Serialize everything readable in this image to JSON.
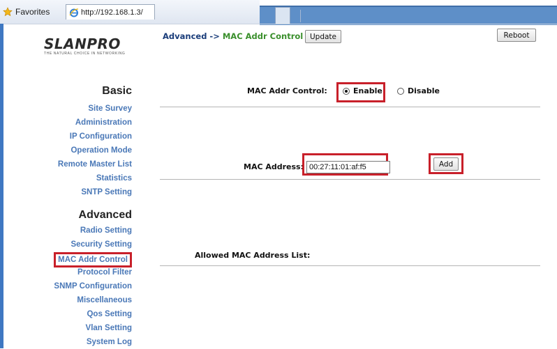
{
  "browser": {
    "favorites_label": "Favorites",
    "tab_url": "http://192.168.1.3/"
  },
  "sidebar": {
    "logo_text": "SLANPRO",
    "logo_tagline": "THE NATURAL CHOICE IN NETWORKING",
    "basic_title": "Basic",
    "basic_items": [
      {
        "label": "Site Survey"
      },
      {
        "label": "Administration"
      },
      {
        "label": "IP Configuration"
      },
      {
        "label": "Operation Mode"
      },
      {
        "label": "Remote Master List"
      },
      {
        "label": "Statistics"
      },
      {
        "label": "SNTP Setting"
      }
    ],
    "advanced_title": "Advanced",
    "advanced_items": [
      {
        "label": "Radio Setting"
      },
      {
        "label": "Security Setting"
      },
      {
        "label": "MAC Addr Control"
      },
      {
        "label": "Protocol Filter"
      },
      {
        "label": "SNMP Configuration"
      },
      {
        "label": "Miscellaneous"
      },
      {
        "label": "Qos Setting"
      },
      {
        "label": "Vlan Setting"
      },
      {
        "label": "System Log"
      }
    ]
  },
  "main": {
    "breadcrumb_prefix": "Advanced ->",
    "breadcrumb_current": "MAC Addr Control",
    "update_label": "Update",
    "reboot_label": "Reboot",
    "mac_control_label": "MAC Addr Control:",
    "enable_label": "Enable",
    "disable_label": "Disable",
    "mac_control_selected": "Enable",
    "mac_address_label": "MAC Address:",
    "mac_address_value": "00:27:11:01:af:f5",
    "add_label": "Add",
    "allowed_list_label": "Allowed MAC Address List:"
  },
  "colors": {
    "highlight_red": "#c8202a",
    "menu_link": "#4a78b7",
    "breadcrumb_current": "#3a8f2c"
  }
}
